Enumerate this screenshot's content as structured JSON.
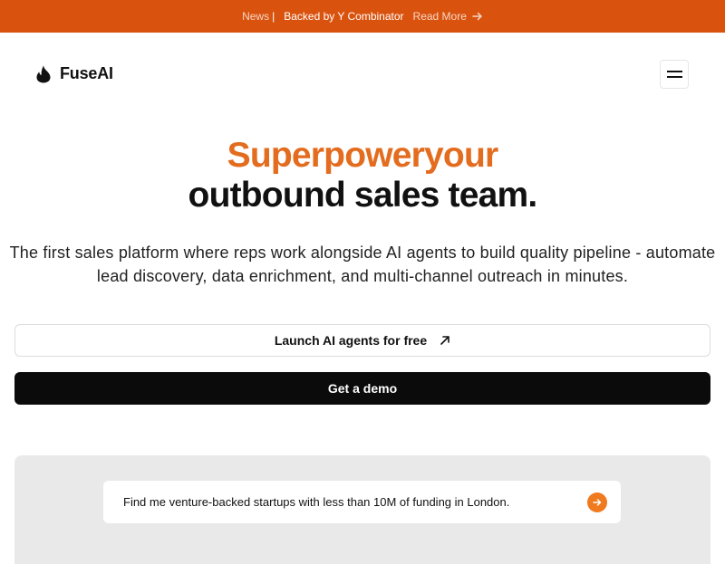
{
  "banner": {
    "news_label": "News",
    "separator": "|",
    "message": "Backed by Y Combinator",
    "link_label": "Read More"
  },
  "nav": {
    "brand_name": "FuseAI"
  },
  "hero": {
    "title_accent": "Superpoweryour",
    "title_main": "outbound sales team.",
    "subtitle": "The first sales platform where reps work alongside AI agents to build quality pipeline - automate lead discovery, data enrichment, and multi-channel outreach in minutes."
  },
  "cta": {
    "primary_label": "Launch AI agents for free",
    "secondary_label": "Get a demo"
  },
  "demo": {
    "prompt_text": "Find me venture-backed startups with less than 10M of funding in London."
  },
  "colors": {
    "banner_bg": "#d9530f",
    "accent": "#e36c1e",
    "send_button": "#f07a1e",
    "dark_button": "#0b0b0b",
    "panel_bg": "#e9e9e9"
  },
  "icons": {
    "logo": "flame-icon",
    "banner_arrow": "arrow-right-icon",
    "launch_arrow": "arrow-up-right-icon",
    "menu": "hamburger-menu-icon",
    "send": "arrow-right-icon"
  }
}
